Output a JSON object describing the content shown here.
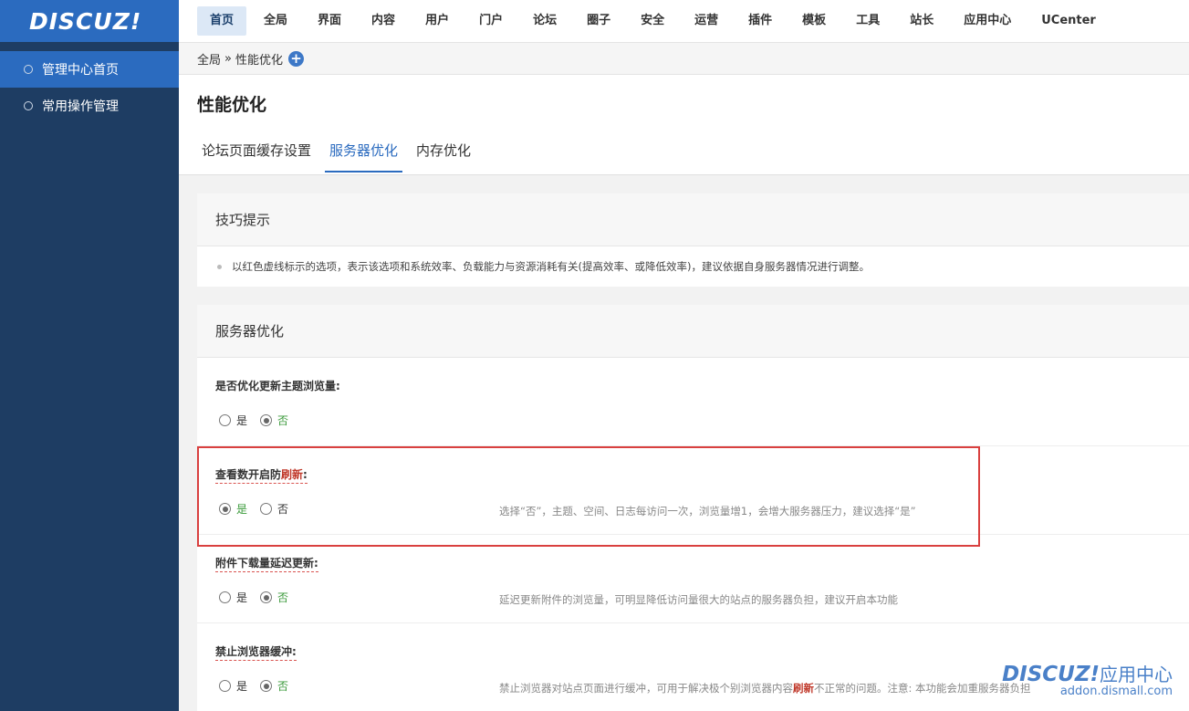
{
  "sidebar": {
    "logo": "DISCUZ!",
    "items": [
      {
        "label": "管理中心首页"
      },
      {
        "label": "常用操作管理"
      }
    ]
  },
  "topnav": {
    "items": [
      "首页",
      "全局",
      "界面",
      "内容",
      "用户",
      "门户",
      "论坛",
      "圈子",
      "安全",
      "运营",
      "插件",
      "模板",
      "工具",
      "站长",
      "应用中心",
      "UCenter"
    ]
  },
  "breadcrumb": {
    "parent": "全局",
    "separator": "»",
    "current": "性能优化",
    "plus": "+"
  },
  "page": {
    "title": "性能优化",
    "tabs": [
      "论坛页面缓存设置",
      "服务器优化",
      "内存优化"
    ]
  },
  "tips": {
    "title": "技巧提示",
    "text": "以红色虚线标示的选项，表示该选项和系统效率、负载能力与资源消耗有关(提高效率、或降低效率)，建议依据自身服务器情况进行调整。"
  },
  "section": {
    "title": "服务器优化",
    "yes": "是",
    "no": "否",
    "rows": [
      {
        "label": "是否优化更新主题浏览量:",
        "desc": ""
      },
      {
        "label_a": "查看数开启防",
        "label_b": "刷新",
        "label_c": ":",
        "desc": "选择“否”，主题、空间、日志每访问一次，浏览量增1，会增大服务器压力，建议选择“是”"
      },
      {
        "label": "附件下载量延迟更新:",
        "desc": "延迟更新附件的浏览量，可明显降低访问量很大的站点的服务器负担，建议开启本功能"
      },
      {
        "label": "禁止浏览器缓冲:",
        "desc_a": "禁止浏览器对站点页面进行缓冲，可用于解决极个别浏览器内容",
        "desc_b": "刷新",
        "desc_c": "不正常的问题。注意: 本功能会加重服务器负担"
      }
    ]
  },
  "watermark": {
    "brand": "DISCUZ!",
    "cn": "应用中心",
    "url": "addon.dismall.com"
  }
}
